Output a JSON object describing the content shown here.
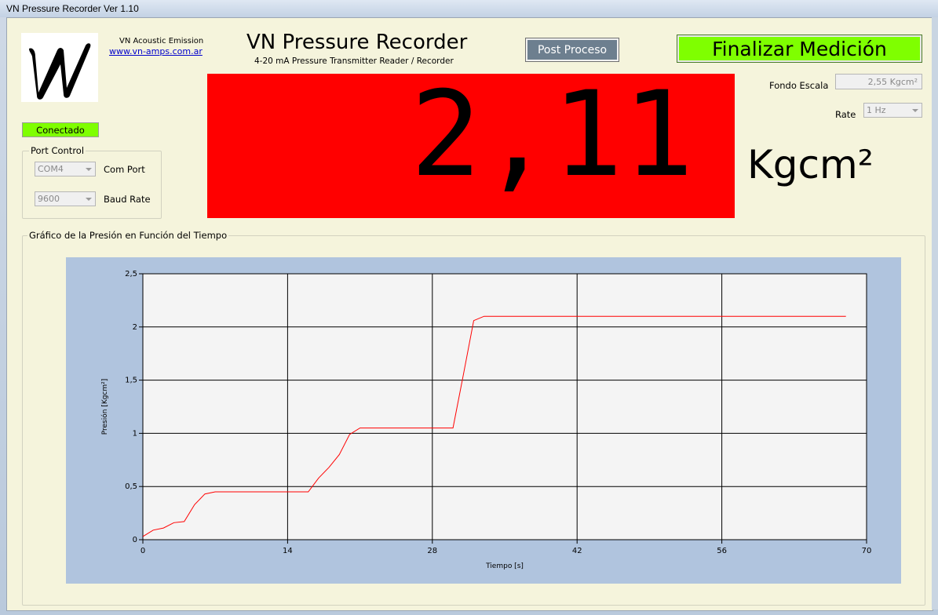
{
  "window": {
    "title": "VN Pressure Recorder Ver 1.10"
  },
  "header": {
    "company": "VN Acoustic Emission",
    "website": "www.vn-amps.com.ar",
    "app_title": "VN Pressure Recorder",
    "app_subtitle": "4-20 mA Pressure Transmitter Reader / Recorder",
    "post_button": "Post Proceso",
    "finish_button": "Finalizar Medición"
  },
  "connection": {
    "status": "Conectado"
  },
  "port_control": {
    "legend": "Port Control",
    "com_port": {
      "value": "COM4",
      "label": "Com Port"
    },
    "baud_rate": {
      "value": "9600",
      "label": "Baud Rate"
    }
  },
  "reading": {
    "value": "2,11",
    "unit": "Kgcm²"
  },
  "settings": {
    "full_scale_label": "Fondo Escala",
    "full_scale_value": "2,55 Kgcm²",
    "rate_label": "Rate",
    "rate_value": "1 Hz"
  },
  "colors": {
    "display_bg": "#ff0000",
    "accent_green": "#7fff00",
    "plot_line": "#ff0000",
    "chart_bg": "#b0c4de"
  },
  "chart_group": {
    "legend": "Gráfico de la Presión en Función del Tiempo"
  },
  "chart_data": {
    "type": "line",
    "xlabel": "Tiempo [s]",
    "ylabel": "Presión [Kgcm²]",
    "xlim": [
      0,
      70
    ],
    "ylim": [
      0,
      2.5
    ],
    "x_ticks": [
      0,
      14,
      28,
      42,
      56,
      70
    ],
    "y_ticks": [
      0,
      0.5,
      1,
      1.5,
      2,
      2.5
    ],
    "x_tick_labels": [
      "0",
      "14",
      "28",
      "42",
      "56",
      "70"
    ],
    "y_tick_labels": [
      "0",
      "0,5",
      "1",
      "1,5",
      "2",
      "2,5"
    ],
    "grid": true,
    "series": [
      {
        "x": [
          0,
          1,
          2,
          3,
          4,
          5,
          6,
          7,
          8,
          10,
          14,
          16,
          17,
          18,
          19,
          20,
          21,
          23,
          28,
          30,
          31,
          32,
          33,
          40,
          50,
          60,
          68
        ],
        "y": [
          0.03,
          0.09,
          0.11,
          0.16,
          0.17,
          0.33,
          0.43,
          0.45,
          0.45,
          0.45,
          0.45,
          0.45,
          0.58,
          0.68,
          0.8,
          0.99,
          1.05,
          1.05,
          1.05,
          1.05,
          1.55,
          2.06,
          2.1,
          2.1,
          2.1,
          2.1,
          2.1
        ]
      }
    ]
  }
}
